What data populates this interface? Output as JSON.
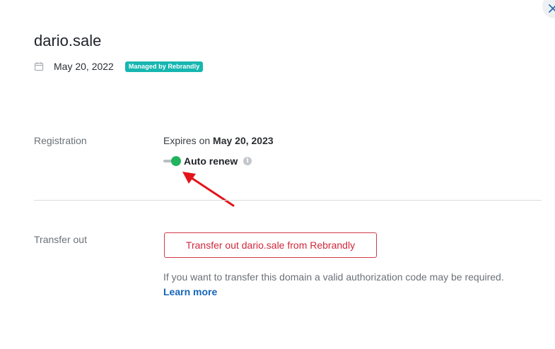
{
  "header": {
    "domain": "dario.sale",
    "date": "May 20, 2022",
    "badge": "Managed by Rebrandly"
  },
  "registration": {
    "label": "Registration",
    "expires_prefix": "Expires on",
    "expires_date": "May 20, 2023",
    "auto_renew_label": "Auto renew",
    "auto_renew_on": true
  },
  "transfer": {
    "label": "Transfer out",
    "button_label": "Transfer out dario.sale from Rebrandly",
    "help_text": "If you want to transfer this domain a valid authorization code may be required.",
    "learn_more": "Learn more"
  },
  "icons": {
    "close": "close-icon",
    "calendar": "calendar-icon",
    "info": "info-icon",
    "arrow": "red-arrow-annotation"
  },
  "colors": {
    "badge": "#17b6b1",
    "toggle_on": "#22b35e",
    "danger": "#d0283a",
    "link": "#1565b8",
    "annotation": "#e3141b"
  }
}
